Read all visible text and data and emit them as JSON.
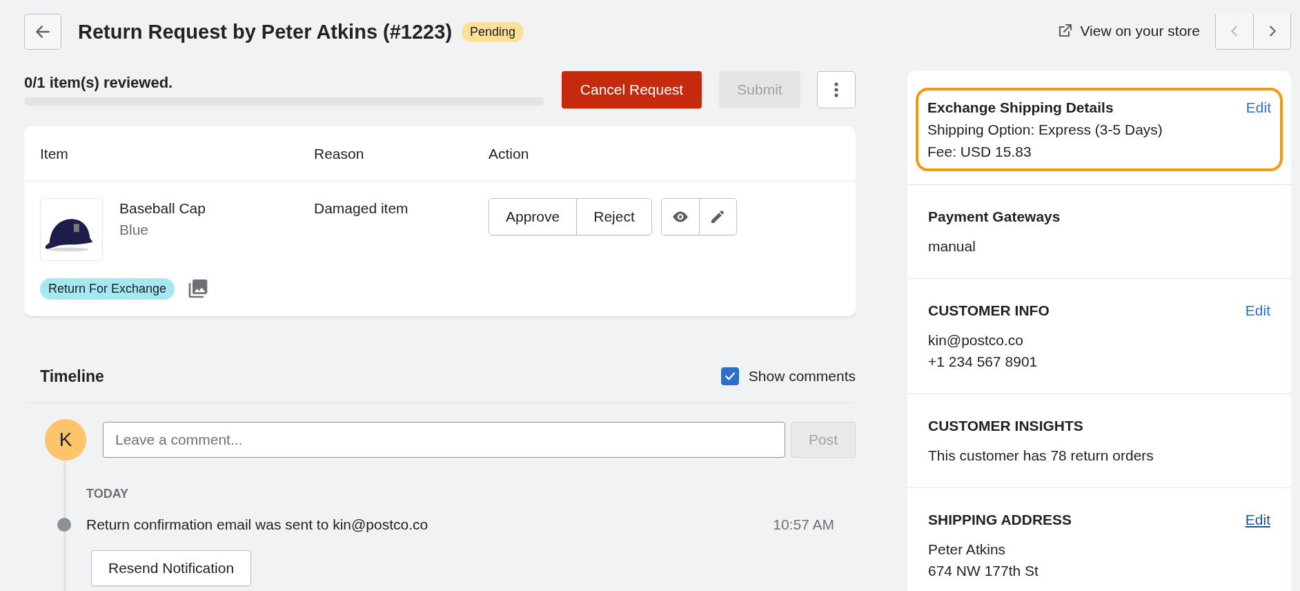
{
  "header": {
    "title": "Return Request by Peter Atkins (#1223)",
    "status_badge": "Pending",
    "view_store_link": "View on your store"
  },
  "review": {
    "progress_text": "0/1 item(s) reviewed.",
    "level": 0,
    "cancel_button": "Cancel Request",
    "submit_button": {
      "label": "Submit",
      "disabled": true
    }
  },
  "items_table": {
    "columns": [
      "Item",
      "Reason",
      "Action"
    ],
    "rows": [
      {
        "name": "Baseball Cap",
        "variant": "Blue",
        "reason": "Damaged item",
        "actions": [
          "Approve",
          "Reject"
        ],
        "tag": "Return For Exchange"
      }
    ]
  },
  "timeline": {
    "title": "Timeline",
    "show_comments": {
      "label": "Show comments",
      "checked": true
    },
    "avatar_initial": "K",
    "comment": {
      "placeholder": "Leave a comment..."
    },
    "post_button": {
      "label": "Post",
      "disabled": true
    },
    "groups": [
      {
        "date": "TODAY",
        "events": [
          {
            "text": "Return confirmation email was sent to kin@postco.co",
            "time": "10:57 AM",
            "action": "Resend Notification"
          }
        ]
      }
    ]
  },
  "sidebar": {
    "sections": [
      {
        "title": "Exchange Shipping Details",
        "highlighted": true,
        "edit": {
          "label": "Edit",
          "hovered": false
        },
        "lines": [
          "Shipping Option: Express (3-5 Days)",
          "Fee: USD 15.83"
        ]
      },
      {
        "title": "Payment Gateways",
        "highlighted": false,
        "lines": [
          "manual"
        ]
      },
      {
        "title": "CUSTOMER INFO",
        "highlighted": false,
        "edit": {
          "label": "Edit",
          "hovered": false
        },
        "lines": [
          "kin@postco.co",
          "+1 234 567 8901"
        ]
      },
      {
        "title": "CUSTOMER INSIGHTS",
        "highlighted": false,
        "lines": [
          "This customer has 78 return orders"
        ]
      },
      {
        "title": "SHIPPING ADDRESS",
        "highlighted": false,
        "edit": {
          "label": "Edit",
          "hovered": true
        },
        "lines": [
          "Peter Atkins",
          "674 NW 177th St"
        ]
      }
    ]
  }
}
